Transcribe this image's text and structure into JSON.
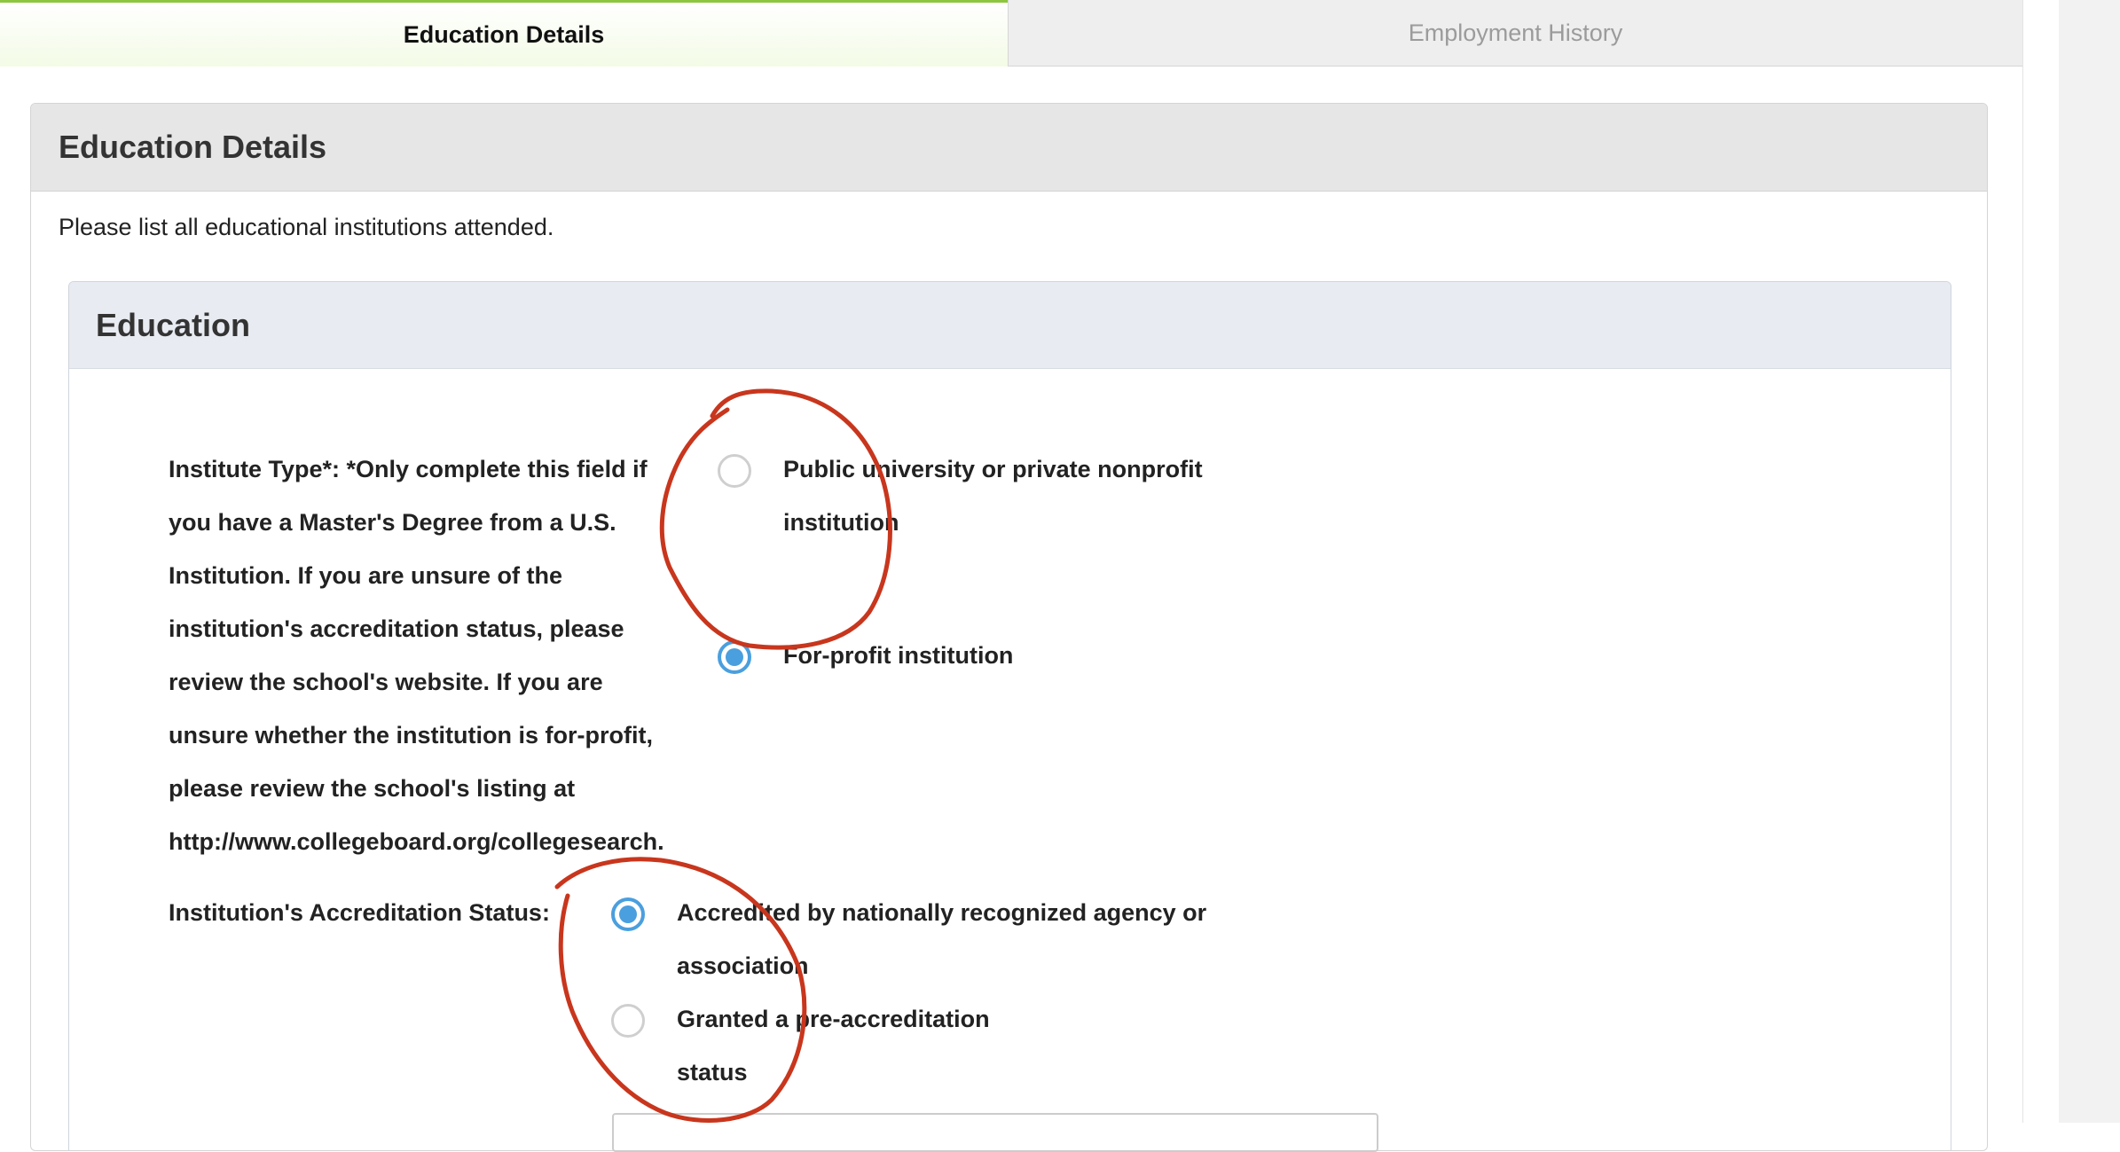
{
  "tabs": [
    {
      "label": "Education Details",
      "active": true
    },
    {
      "label": "Employment History",
      "active": false
    }
  ],
  "section": {
    "title": "Education Details",
    "intro": "Please list all educational institutions attended."
  },
  "education": {
    "title": "Education",
    "institute_type": {
      "label_lines": [
        "Institute Type*: *Only complete this field if",
        "you have a Master's Degree from a U.S.",
        "Institution. If you are unsure of the",
        "institution's accreditation status, please",
        "review the school's website. If you are",
        "unsure whether the institution is for-profit,",
        "please review the school's listing at",
        "http://www.collegeboard.org/collegesearch."
      ],
      "options": [
        {
          "lines": [
            "Public university or private nonprofit",
            "institution"
          ],
          "selected": false
        },
        {
          "lines": [
            "For-profit institution"
          ],
          "selected": true
        }
      ]
    },
    "accreditation": {
      "label": "Institution's Accreditation Status:",
      "options": [
        {
          "lines": [
            "Accredited by nationally recognized agency or",
            "association"
          ],
          "selected": true
        },
        {
          "lines": [
            "Granted a pre-accreditation",
            "status"
          ],
          "selected": false
        }
      ]
    }
  },
  "colors": {
    "tab_accent": "#8cc63f",
    "radio_selected": "#4a9fde",
    "annotation": "#c8361d"
  }
}
